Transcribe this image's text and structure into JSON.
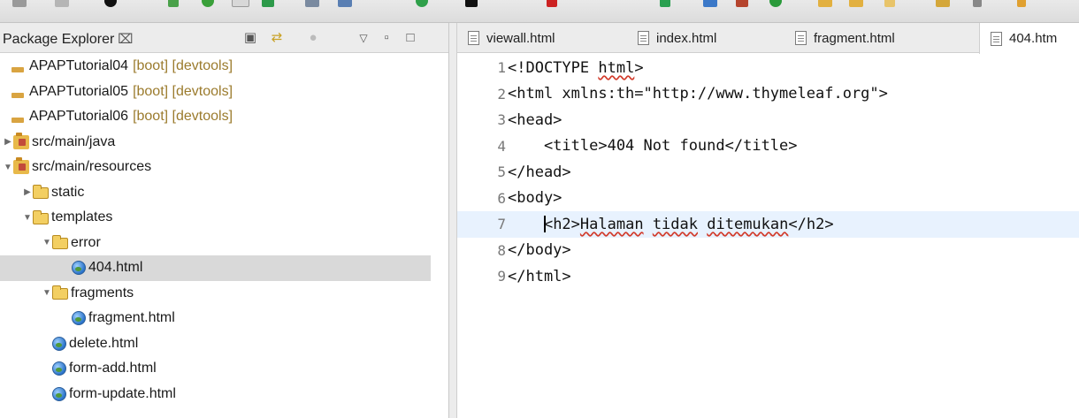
{
  "package_explorer": {
    "title": "Package Explorer",
    "close_glyph": "⌧",
    "tree": [
      {
        "indent": 0,
        "twisty": "",
        "icon": "project",
        "label": "APAPTutorial04",
        "decoration": "[boot] [devtools]"
      },
      {
        "indent": 0,
        "twisty": "",
        "icon": "project",
        "label": "APAPTutorial05",
        "decoration": "[boot] [devtools]"
      },
      {
        "indent": 0,
        "twisty": "",
        "icon": "project",
        "label": "APAPTutorial06",
        "decoration": "[boot] [devtools]"
      },
      {
        "indent": 0,
        "twisty": "▶",
        "icon": "source-folder",
        "label": "src/main/java",
        "decoration": ""
      },
      {
        "indent": 0,
        "twisty": "▼",
        "icon": "source-folder",
        "label": "src/main/resources",
        "decoration": ""
      },
      {
        "indent": 1,
        "twisty": "▶",
        "icon": "folder",
        "label": "static",
        "decoration": ""
      },
      {
        "indent": 1,
        "twisty": "▼",
        "icon": "folder",
        "label": "templates",
        "decoration": ""
      },
      {
        "indent": 2,
        "twisty": "▼",
        "icon": "folder",
        "label": "error",
        "decoration": ""
      },
      {
        "indent": 3,
        "twisty": "",
        "icon": "html-file",
        "label": "404.html",
        "decoration": "",
        "selected": true
      },
      {
        "indent": 2,
        "twisty": "▼",
        "icon": "folder",
        "label": "fragments",
        "decoration": ""
      },
      {
        "indent": 3,
        "twisty": "",
        "icon": "html-file",
        "label": "fragment.html",
        "decoration": ""
      },
      {
        "indent": 2,
        "twisty": "",
        "icon": "html-file",
        "label": "delete.html",
        "decoration": ""
      },
      {
        "indent": 2,
        "twisty": "",
        "icon": "html-file",
        "label": "form-add.html",
        "decoration": ""
      },
      {
        "indent": 2,
        "twisty": "",
        "icon": "html-file",
        "label": "form-update.html",
        "decoration": ""
      }
    ]
  },
  "editor": {
    "tabs": [
      {
        "label": "viewall.html",
        "active": false
      },
      {
        "label": "index.html",
        "active": false
      },
      {
        "label": "fragment.html",
        "active": false
      },
      {
        "label": "404.htm",
        "active": true
      }
    ],
    "lines": [
      {
        "num": "1",
        "parts": [
          {
            "t": "<!DOCTYPE "
          },
          {
            "t": "html",
            "err": true
          },
          {
            "t": ">"
          }
        ]
      },
      {
        "num": "2",
        "parts": [
          {
            "t": "<html xmlns:th=\"http://www.thymeleaf.org\">"
          }
        ]
      },
      {
        "num": "3",
        "parts": [
          {
            "t": "<head>"
          }
        ]
      },
      {
        "num": "4",
        "parts": [
          {
            "t": "    <title>404 Not found</title>"
          }
        ]
      },
      {
        "num": "5",
        "parts": [
          {
            "t": "</head>"
          }
        ]
      },
      {
        "num": "6",
        "parts": [
          {
            "t": "<body>"
          }
        ]
      },
      {
        "num": "7",
        "current": true,
        "parts": [
          {
            "t": "    "
          },
          {
            "caret": true
          },
          {
            "t": "<h2>"
          },
          {
            "t": "Halaman",
            "err": true
          },
          {
            "t": " "
          },
          {
            "t": "tidak",
            "err": true
          },
          {
            "t": " "
          },
          {
            "t": "ditemukan",
            "err": true
          },
          {
            "t": "</h2>"
          }
        ]
      },
      {
        "num": "8",
        "parts": [
          {
            "t": "</body>"
          }
        ]
      },
      {
        "num": "9",
        "parts": [
          {
            "t": "</html>"
          }
        ]
      }
    ]
  }
}
